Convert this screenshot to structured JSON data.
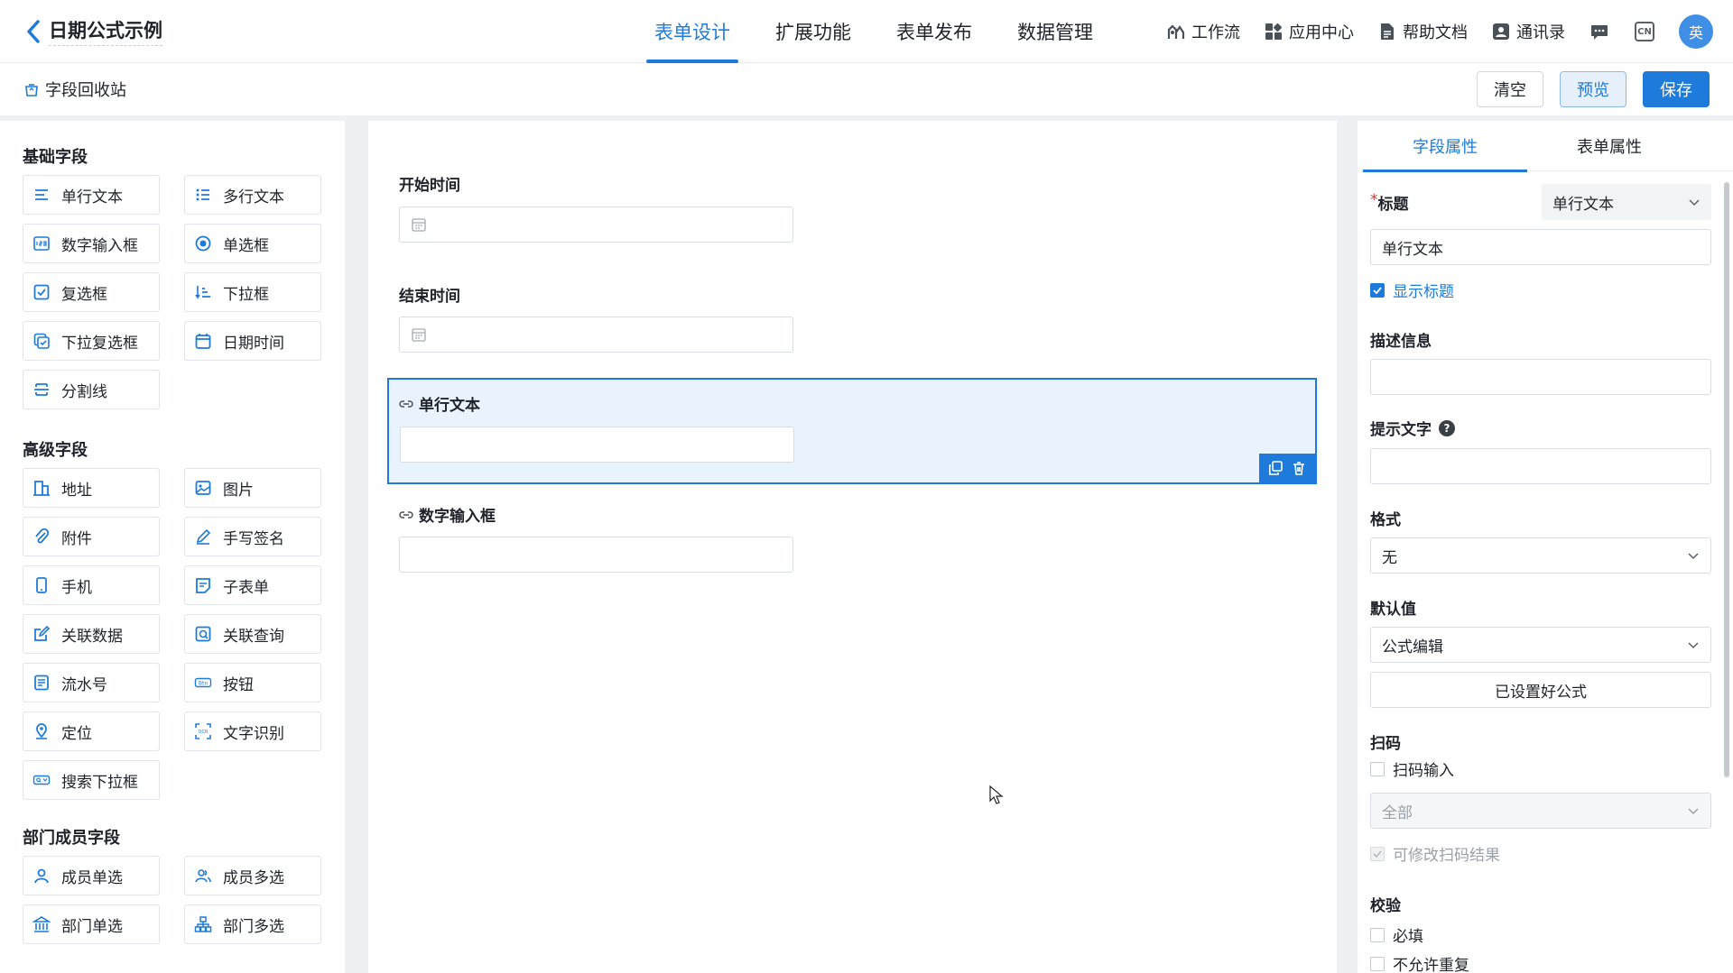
{
  "header": {
    "app_title": "日期公式示例",
    "tabs": [
      {
        "label": "表单设计"
      },
      {
        "label": "扩展功能"
      },
      {
        "label": "表单发布"
      },
      {
        "label": "数据管理"
      }
    ],
    "tools": {
      "workflow": "工作流",
      "app_center": "应用中心",
      "help_docs": "帮助文档",
      "contacts": "通讯录",
      "lang_badge": "CN",
      "avatar_text": "英"
    }
  },
  "subbar": {
    "recycle_label": "字段回收站",
    "clear_label": "清空",
    "preview_label": "预览",
    "save_label": "保存"
  },
  "left_panel": {
    "basic_title": "基础字段",
    "basic": [
      "单行文本",
      "多行文本",
      "数字输入框",
      "单选框",
      "复选框",
      "下拉框",
      "下拉复选框",
      "日期时间",
      "分割线"
    ],
    "advanced_title": "高级字段",
    "advanced": [
      "地址",
      "图片",
      "附件",
      "手写签名",
      "手机",
      "子表单",
      "关联数据",
      "关联查询",
      "流水号",
      "按钮",
      "定位",
      "文字识别",
      "搜索下拉框"
    ],
    "member_title": "部门成员字段",
    "member": [
      "成员单选",
      "成员多选",
      "部门单选",
      "部门多选"
    ]
  },
  "canvas": {
    "start_time_label": "开始时间",
    "end_time_label": "结束时间",
    "single_text_label": "单行文本",
    "number_label": "数字输入框"
  },
  "right_panel": {
    "tabs": {
      "field": "字段属性",
      "form": "表单属性"
    },
    "title_label": "标题",
    "title_required_mark": "*",
    "title_type": "单行文本",
    "title_value": "单行文本",
    "show_title": "显示标题",
    "description_label": "描述信息",
    "description_value": "",
    "hint_label": "提示文字",
    "hint_icon": "?",
    "hint_value": "",
    "format_label": "格式",
    "format_value": "无",
    "default_label": "默认值",
    "default_value": "公式编辑",
    "formula_button": "已设置好公式",
    "scan_label": "扫码",
    "scan_input": "扫码输入",
    "scan_scope": "全部",
    "scan_editable": "可修改扫码结果",
    "validation_label": "校验",
    "required": "必填",
    "no_duplicate": "不允许重复"
  },
  "colors": {
    "accent": "#1e7bdb",
    "selected_bg": "#e9f3fd"
  }
}
